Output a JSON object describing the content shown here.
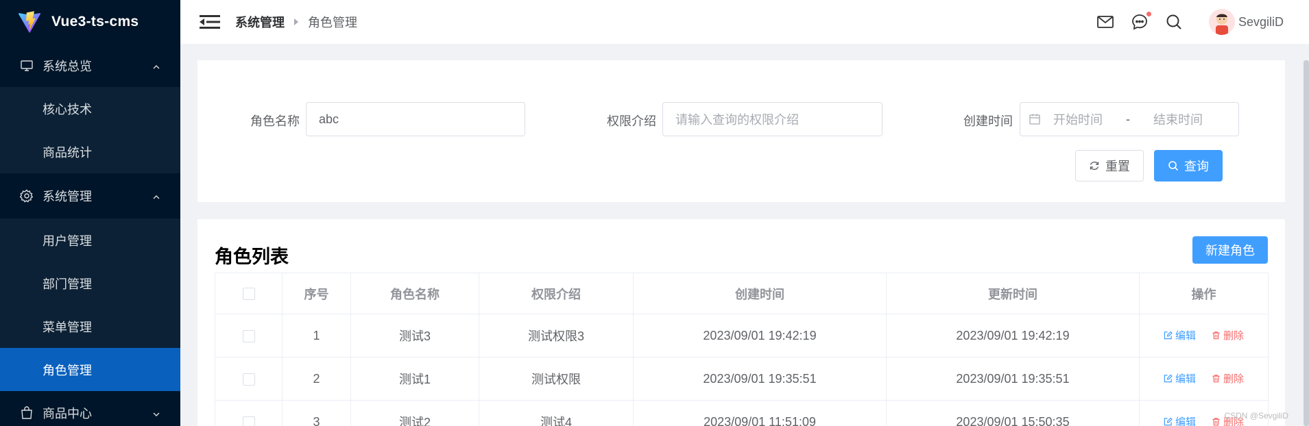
{
  "app": {
    "title": "Vue3-ts-cms",
    "logo_icon": "vite-logo-icon"
  },
  "sidebar": {
    "groups": [
      {
        "label": "系统总览",
        "icon": "monitor-icon",
        "expanded": true,
        "items": [
          {
            "label": "核心技术",
            "active": false
          },
          {
            "label": "商品统计",
            "active": false
          }
        ]
      },
      {
        "label": "系统管理",
        "icon": "setting-icon",
        "expanded": true,
        "items": [
          {
            "label": "用户管理",
            "active": false
          },
          {
            "label": "部门管理",
            "active": false
          },
          {
            "label": "菜单管理",
            "active": false
          },
          {
            "label": "角色管理",
            "active": true
          }
        ]
      },
      {
        "label": "商品中心",
        "icon": "shopping-bag-icon",
        "expanded": false,
        "items": []
      }
    ]
  },
  "header": {
    "breadcrumb": [
      "系统管理",
      "角色管理"
    ],
    "icons": [
      "mail-icon",
      "chat-icon",
      "search-icon"
    ],
    "username": "SevgiliD"
  },
  "search": {
    "role_name_label": "角色名称",
    "role_name_value": "abc",
    "intro_label": "权限介绍",
    "intro_placeholder": "请输入查询的权限介绍",
    "create_time_label": "创建时间",
    "start_placeholder": "开始时间",
    "range_separator": "-",
    "end_placeholder": "结束时间",
    "reset_label": "重置",
    "query_label": "查询"
  },
  "table": {
    "title": "角色列表",
    "new_button": "新建角色",
    "columns": [
      "序号",
      "角色名称",
      "权限介绍",
      "创建时间",
      "更新时间",
      "操作"
    ],
    "rows": [
      {
        "index": "1",
        "name": "测试3",
        "intro": "测试权限3",
        "created": "2023/09/01 19:42:19",
        "updated": "2023/09/01 19:42:19"
      },
      {
        "index": "2",
        "name": "测试1",
        "intro": "测试权限",
        "created": "2023/09/01 19:35:51",
        "updated": "2023/09/01 19:35:51"
      },
      {
        "index": "3",
        "name": "测试2",
        "intro": "测试4",
        "created": "2023/09/01 11:51:09",
        "updated": "2023/09/01 15:50:35"
      }
    ],
    "edit_label": "编辑",
    "delete_label": "删除"
  },
  "watermark": "CSDN @SevgiliD",
  "colors": {
    "sidebar_bg": "#001529",
    "submenu_bg": "#0c2135",
    "active_bg": "#0a60bd",
    "primary": "#409eff",
    "danger": "#f56c6c"
  }
}
